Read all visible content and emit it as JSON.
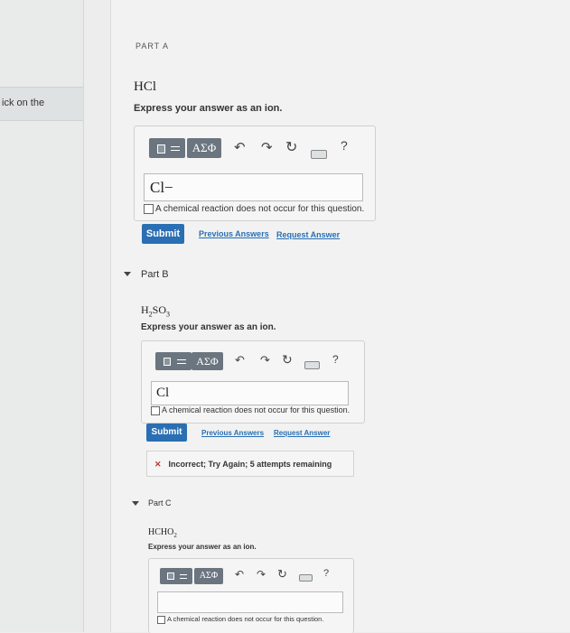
{
  "sidebar": {
    "tab_label": "ick on the"
  },
  "top_part": {
    "title_fragment": "PART A",
    "formula": "HCl",
    "instruction": "Express your answer as an ion.",
    "toolbar": {
      "symbols_label": "ΑΣΦ",
      "help_label": "?"
    },
    "answer_value": "Cl−",
    "checkbox_label": "A chemical reaction does not occur for this question.",
    "submit_label": "Submit",
    "previous_answers_label": "Previous Answers",
    "request_answer_label": "Request Answer"
  },
  "part_b": {
    "header": "Part B",
    "formula_main": "H",
    "formula_sub1": "2",
    "formula_mid": "SO",
    "formula_sub2": "3",
    "instruction": "Express your answer as an ion.",
    "toolbar": {
      "symbols_label": "ΑΣΦ",
      "help_label": "?"
    },
    "answer_value": "Cl",
    "checkbox_label": "A chemical reaction does not occur for this question.",
    "submit_label": "Submit",
    "previous_answers_label": "Previous Answers",
    "request_answer_label": "Request Answer",
    "feedback": "Incorrect; Try Again; 5 attempts remaining",
    "feedback_icon": "✕"
  },
  "part_c": {
    "header": "Part C",
    "formula_main": "HCHO",
    "formula_sub": "2",
    "instruction": "Express your answer as an ion.",
    "toolbar": {
      "symbols_label": "ΑΣΦ",
      "help_label": "?"
    },
    "answer_value": "",
    "checkbox_label": "A chemical reaction does not occur for this question."
  },
  "icons": {
    "undo": "↶",
    "redo": "↷",
    "reset": "↻",
    "keyboard": "keyboard-icon"
  },
  "colors": {
    "accent": "#2a6fb3",
    "error": "#c0392b",
    "toolbar_button": "#6b7580"
  }
}
